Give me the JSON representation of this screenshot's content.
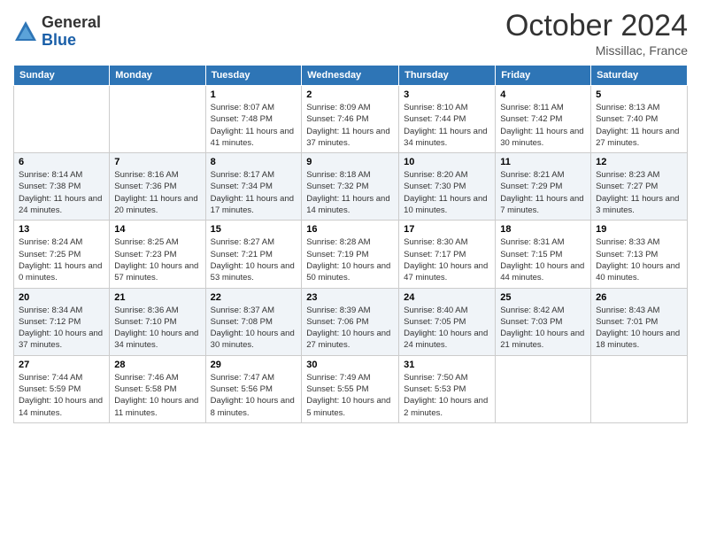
{
  "header": {
    "logo": {
      "general": "General",
      "blue": "Blue"
    },
    "title": "October 2024",
    "location": "Missillac, France"
  },
  "weekdays": [
    "Sunday",
    "Monday",
    "Tuesday",
    "Wednesday",
    "Thursday",
    "Friday",
    "Saturday"
  ],
  "weeks": [
    [
      {
        "day": "",
        "info": ""
      },
      {
        "day": "",
        "info": ""
      },
      {
        "day": "1",
        "info": "Sunrise: 8:07 AM\nSunset: 7:48 PM\nDaylight: 11 hours and 41 minutes."
      },
      {
        "day": "2",
        "info": "Sunrise: 8:09 AM\nSunset: 7:46 PM\nDaylight: 11 hours and 37 minutes."
      },
      {
        "day": "3",
        "info": "Sunrise: 8:10 AM\nSunset: 7:44 PM\nDaylight: 11 hours and 34 minutes."
      },
      {
        "day": "4",
        "info": "Sunrise: 8:11 AM\nSunset: 7:42 PM\nDaylight: 11 hours and 30 minutes."
      },
      {
        "day": "5",
        "info": "Sunrise: 8:13 AM\nSunset: 7:40 PM\nDaylight: 11 hours and 27 minutes."
      }
    ],
    [
      {
        "day": "6",
        "info": "Sunrise: 8:14 AM\nSunset: 7:38 PM\nDaylight: 11 hours and 24 minutes."
      },
      {
        "day": "7",
        "info": "Sunrise: 8:16 AM\nSunset: 7:36 PM\nDaylight: 11 hours and 20 minutes."
      },
      {
        "day": "8",
        "info": "Sunrise: 8:17 AM\nSunset: 7:34 PM\nDaylight: 11 hours and 17 minutes."
      },
      {
        "day": "9",
        "info": "Sunrise: 8:18 AM\nSunset: 7:32 PM\nDaylight: 11 hours and 14 minutes."
      },
      {
        "day": "10",
        "info": "Sunrise: 8:20 AM\nSunset: 7:30 PM\nDaylight: 11 hours and 10 minutes."
      },
      {
        "day": "11",
        "info": "Sunrise: 8:21 AM\nSunset: 7:29 PM\nDaylight: 11 hours and 7 minutes."
      },
      {
        "day": "12",
        "info": "Sunrise: 8:23 AM\nSunset: 7:27 PM\nDaylight: 11 hours and 3 minutes."
      }
    ],
    [
      {
        "day": "13",
        "info": "Sunrise: 8:24 AM\nSunset: 7:25 PM\nDaylight: 11 hours and 0 minutes."
      },
      {
        "day": "14",
        "info": "Sunrise: 8:25 AM\nSunset: 7:23 PM\nDaylight: 10 hours and 57 minutes."
      },
      {
        "day": "15",
        "info": "Sunrise: 8:27 AM\nSunset: 7:21 PM\nDaylight: 10 hours and 53 minutes."
      },
      {
        "day": "16",
        "info": "Sunrise: 8:28 AM\nSunset: 7:19 PM\nDaylight: 10 hours and 50 minutes."
      },
      {
        "day": "17",
        "info": "Sunrise: 8:30 AM\nSunset: 7:17 PM\nDaylight: 10 hours and 47 minutes."
      },
      {
        "day": "18",
        "info": "Sunrise: 8:31 AM\nSunset: 7:15 PM\nDaylight: 10 hours and 44 minutes."
      },
      {
        "day": "19",
        "info": "Sunrise: 8:33 AM\nSunset: 7:13 PM\nDaylight: 10 hours and 40 minutes."
      }
    ],
    [
      {
        "day": "20",
        "info": "Sunrise: 8:34 AM\nSunset: 7:12 PM\nDaylight: 10 hours and 37 minutes."
      },
      {
        "day": "21",
        "info": "Sunrise: 8:36 AM\nSunset: 7:10 PM\nDaylight: 10 hours and 34 minutes."
      },
      {
        "day": "22",
        "info": "Sunrise: 8:37 AM\nSunset: 7:08 PM\nDaylight: 10 hours and 30 minutes."
      },
      {
        "day": "23",
        "info": "Sunrise: 8:39 AM\nSunset: 7:06 PM\nDaylight: 10 hours and 27 minutes."
      },
      {
        "day": "24",
        "info": "Sunrise: 8:40 AM\nSunset: 7:05 PM\nDaylight: 10 hours and 24 minutes."
      },
      {
        "day": "25",
        "info": "Sunrise: 8:42 AM\nSunset: 7:03 PM\nDaylight: 10 hours and 21 minutes."
      },
      {
        "day": "26",
        "info": "Sunrise: 8:43 AM\nSunset: 7:01 PM\nDaylight: 10 hours and 18 minutes."
      }
    ],
    [
      {
        "day": "27",
        "info": "Sunrise: 7:44 AM\nSunset: 5:59 PM\nDaylight: 10 hours and 14 minutes."
      },
      {
        "day": "28",
        "info": "Sunrise: 7:46 AM\nSunset: 5:58 PM\nDaylight: 10 hours and 11 minutes."
      },
      {
        "day": "29",
        "info": "Sunrise: 7:47 AM\nSunset: 5:56 PM\nDaylight: 10 hours and 8 minutes."
      },
      {
        "day": "30",
        "info": "Sunrise: 7:49 AM\nSunset: 5:55 PM\nDaylight: 10 hours and 5 minutes."
      },
      {
        "day": "31",
        "info": "Sunrise: 7:50 AM\nSunset: 5:53 PM\nDaylight: 10 hours and 2 minutes."
      },
      {
        "day": "",
        "info": ""
      },
      {
        "day": "",
        "info": ""
      }
    ]
  ]
}
